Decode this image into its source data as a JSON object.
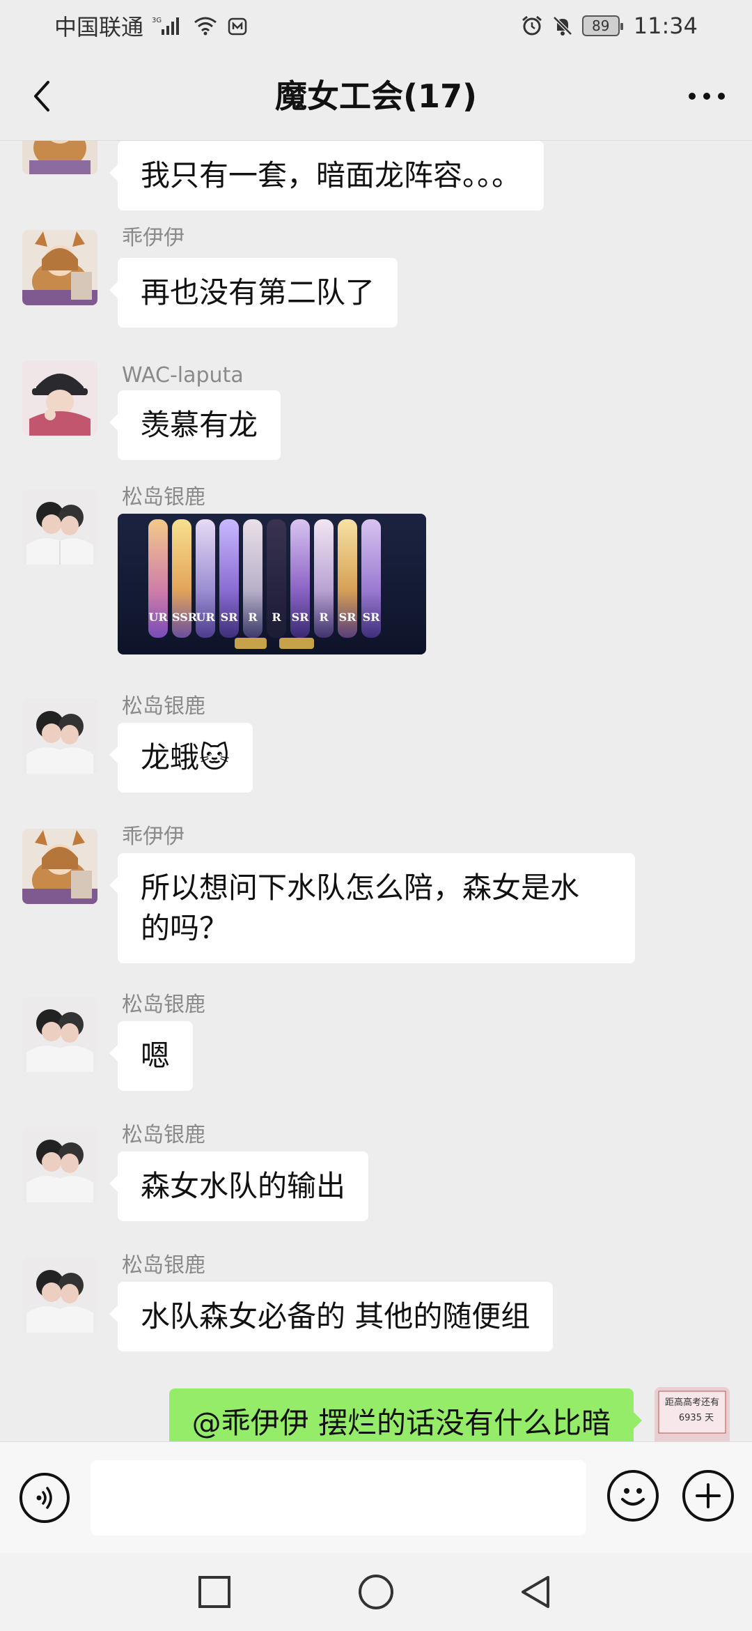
{
  "status_bar": {
    "carrier": "中国联通",
    "network": "3G",
    "battery": "89",
    "time": "11:34"
  },
  "header": {
    "title": "魔女工会(17)",
    "back_icon": "chevron-left-icon",
    "more_icon": "more-dots-icon"
  },
  "messages": [
    {
      "sender": "",
      "text": "我只有一套，暗面龙阵容。。。",
      "avatar": "anime-girl"
    },
    {
      "sender": "乖伊伊",
      "text": "再也没有第二队了",
      "avatar": "anime-girl"
    },
    {
      "sender": "WAC-laputa",
      "text": "羡慕有龙",
      "avatar": "cap-person"
    },
    {
      "sender": "松岛银鹿",
      "image_labels": [
        "UR",
        "SSR",
        "UR",
        "SR",
        "R",
        "R",
        "SR",
        "R",
        "SR",
        "SR"
      ],
      "avatar": "couple"
    },
    {
      "sender": "松岛银鹿",
      "text": "龙蛾",
      "emoji": "🐱",
      "avatar": "couple"
    },
    {
      "sender": "乖伊伊",
      "text_line1": "所以想问下水队怎么陪，森女是水",
      "text_line2": "的吗？",
      "avatar": "anime-girl"
    },
    {
      "sender": "松岛银鹿",
      "text": "嗯",
      "avatar": "couple"
    },
    {
      "sender": "松岛银鹿",
      "text": "森女水队的输出",
      "avatar": "couple"
    },
    {
      "sender": "松岛银鹿",
      "text": "水队森女必备的 其他的随便组",
      "avatar": "couple"
    },
    {
      "sender": "me",
      "text": "@乖伊伊  摆烂的话没有什么比暗",
      "avatar": "self-sign",
      "avatar_text_1": "距高高考还有",
      "avatar_text_2": "6935 天"
    }
  ],
  "input_bar": {
    "placeholder": "",
    "voice_icon": "voice-icon",
    "emoji_icon": "emoji-icon",
    "plus_icon": "plus-icon"
  },
  "colors": {
    "background": "#ededed",
    "bubble_other": "#ffffff",
    "bubble_mine": "#95ec69",
    "sender_name": "#8a8a8a"
  }
}
